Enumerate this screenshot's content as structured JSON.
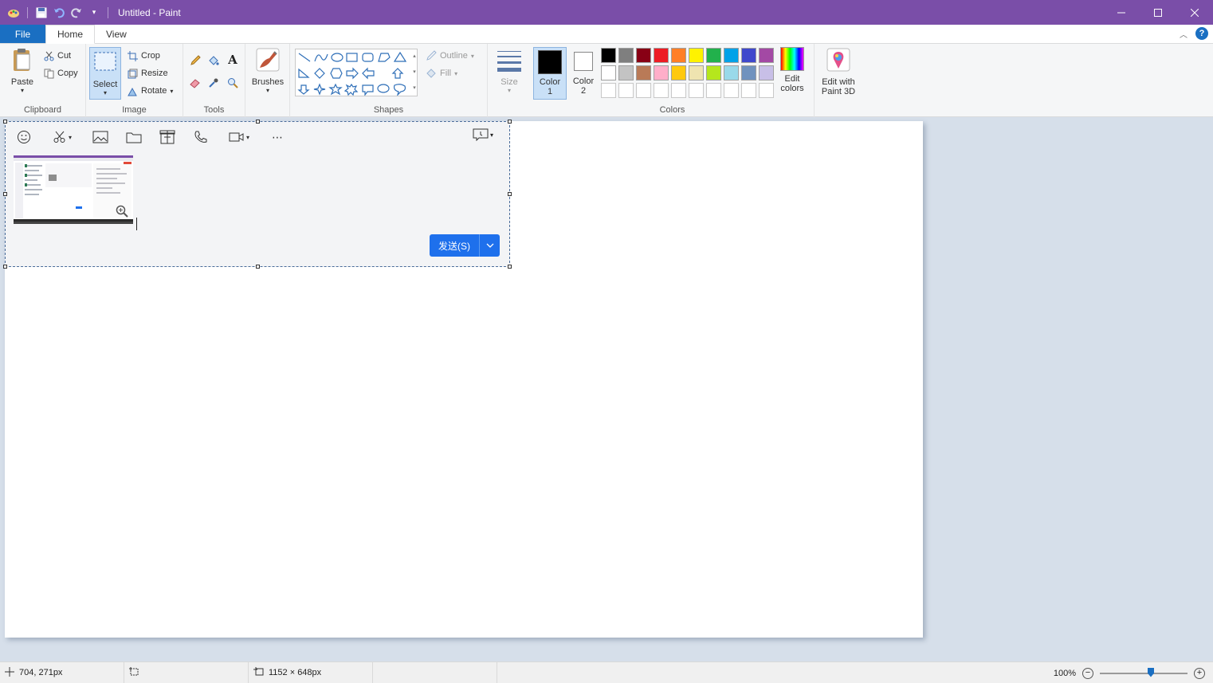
{
  "window": {
    "title": "Untitled - Paint"
  },
  "tabs": {
    "file": "File",
    "home": "Home",
    "view": "View"
  },
  "help": "?",
  "clipboard": {
    "label": "Clipboard",
    "paste": "Paste",
    "cut": "Cut",
    "copy": "Copy"
  },
  "image": {
    "label": "Image",
    "select": "Select",
    "crop": "Crop",
    "resize": "Resize",
    "rotate": "Rotate"
  },
  "tools": {
    "label": "Tools"
  },
  "brushes": {
    "label": "Brushes"
  },
  "shapes": {
    "label": "Shapes",
    "outline": "Outline",
    "fill": "Fill"
  },
  "size": {
    "label": "Size"
  },
  "colors": {
    "label": "Colors",
    "color1_line1": "Color",
    "color1_line2": "1",
    "color2_line1": "Color",
    "color2_line2": "2",
    "color1_value": "#000000",
    "color2_value": "#ffffff",
    "edit_line1": "Edit",
    "edit_line2": "colors",
    "palette_row1": [
      "#000000",
      "#7f7f7f",
      "#880015",
      "#ed1c24",
      "#ff7f27",
      "#fff200",
      "#22b14c",
      "#00a2e8",
      "#3f48cc",
      "#a349a4"
    ],
    "palette_row2": [
      "#ffffff",
      "#c3c3c3",
      "#b97a57",
      "#ffaec9",
      "#ffc90e",
      "#efe4b0",
      "#b5e61d",
      "#99d9ea",
      "#7092be",
      "#c8bfe7"
    ]
  },
  "paint3d": {
    "line1": "Edit with",
    "line2": "Paint 3D"
  },
  "pasted": {
    "send_label": "发送(S)"
  },
  "status": {
    "cursor_pos": "704, 271px",
    "selection_size": "",
    "image_size": "1152 × 648px",
    "zoom": "100%"
  }
}
